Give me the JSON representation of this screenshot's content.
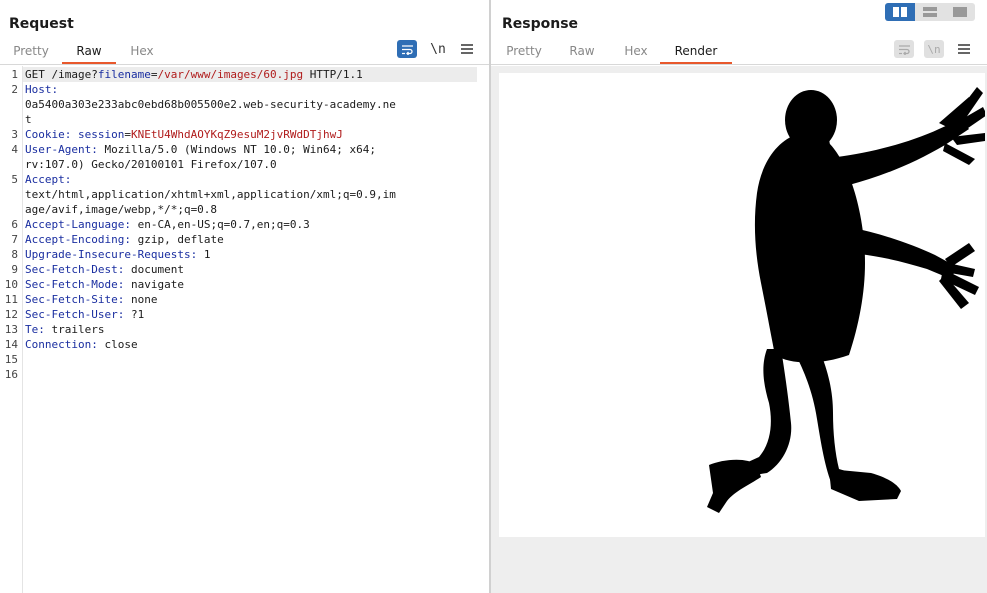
{
  "request": {
    "title": "Request",
    "tabs": [
      "Pretty",
      "Raw",
      "Hex"
    ],
    "active_tab": "Raw",
    "tools": {
      "wrap": "wrap-lines-icon",
      "newline": "\\n",
      "menu": "menu-icon"
    },
    "lines": [
      {
        "n": "1",
        "parts": [
          {
            "t": "GET /image?",
            "c": "plain"
          },
          {
            "t": "filename",
            "c": "pk"
          },
          {
            "t": "=",
            "c": "plain"
          },
          {
            "t": "/var/www/images/60.jpg",
            "c": "pv"
          },
          {
            "t": " HTTP/1.1",
            "c": "plain"
          }
        ]
      },
      {
        "n": "2",
        "parts": [
          {
            "t": "Host:",
            "c": "hk"
          }
        ]
      },
      {
        "n": "",
        "parts": [
          {
            "t": "0a5400a303e233abc0ebd68b005500e2.web-security-academy.ne",
            "c": "plain"
          }
        ]
      },
      {
        "n": "",
        "parts": [
          {
            "t": "t",
            "c": "plain"
          }
        ]
      },
      {
        "n": "3",
        "parts": [
          {
            "t": "Cookie: ",
            "c": "hk"
          },
          {
            "t": "session",
            "c": "pk"
          },
          {
            "t": "=",
            "c": "plain"
          },
          {
            "t": "KNEtU4WhdAOYKqZ9esuM2jvRWdDTjhwJ",
            "c": "pv"
          }
        ]
      },
      {
        "n": "4",
        "parts": [
          {
            "t": "User-Agent: ",
            "c": "hk"
          },
          {
            "t": "Mozilla/5.0 (Windows NT 10.0; Win64; x64;",
            "c": "plain"
          }
        ]
      },
      {
        "n": "",
        "parts": [
          {
            "t": "rv:107.0) Gecko/20100101 Firefox/107.0",
            "c": "plain"
          }
        ]
      },
      {
        "n": "5",
        "parts": [
          {
            "t": "Accept:",
            "c": "hk"
          }
        ]
      },
      {
        "n": "",
        "parts": [
          {
            "t": "text/html,application/xhtml+xml,application/xml;q=0.9,im",
            "c": "plain"
          }
        ]
      },
      {
        "n": "",
        "parts": [
          {
            "t": "age/avif,image/webp,*/*;q=0.8",
            "c": "plain"
          }
        ]
      },
      {
        "n": "6",
        "parts": [
          {
            "t": "Accept-Language: ",
            "c": "hk"
          },
          {
            "t": "en-CA,en-US;q=0.7,en;q=0.3",
            "c": "plain"
          }
        ]
      },
      {
        "n": "7",
        "parts": [
          {
            "t": "Accept-Encoding: ",
            "c": "hk"
          },
          {
            "t": "gzip, deflate",
            "c": "plain"
          }
        ]
      },
      {
        "n": "8",
        "parts": [
          {
            "t": "Upgrade-Insecure-Requests: ",
            "c": "hk"
          },
          {
            "t": "1",
            "c": "plain"
          }
        ]
      },
      {
        "n": "9",
        "parts": [
          {
            "t": "Sec-Fetch-Dest: ",
            "c": "hk"
          },
          {
            "t": "document",
            "c": "plain"
          }
        ]
      },
      {
        "n": "10",
        "parts": [
          {
            "t": "Sec-Fetch-Mode: ",
            "c": "hk"
          },
          {
            "t": "navigate",
            "c": "plain"
          }
        ]
      },
      {
        "n": "11",
        "parts": [
          {
            "t": "Sec-Fetch-Site: ",
            "c": "hk"
          },
          {
            "t": "none",
            "c": "plain"
          }
        ]
      },
      {
        "n": "12",
        "parts": [
          {
            "t": "Sec-Fetch-User: ",
            "c": "hk"
          },
          {
            "t": "?1",
            "c": "plain"
          }
        ]
      },
      {
        "n": "13",
        "parts": [
          {
            "t": "Te: ",
            "c": "hk"
          },
          {
            "t": "trailers",
            "c": "plain"
          }
        ]
      },
      {
        "n": "14",
        "parts": [
          {
            "t": "Connection: ",
            "c": "hk"
          },
          {
            "t": "close",
            "c": "plain"
          }
        ]
      },
      {
        "n": "15",
        "parts": []
      },
      {
        "n": "16",
        "parts": []
      }
    ]
  },
  "response": {
    "title": "Response",
    "tabs": [
      "Pretty",
      "Raw",
      "Hex",
      "Render"
    ],
    "active_tab": "Render",
    "tools": {
      "wrap": "wrap-lines-icon",
      "newline": "\\n",
      "menu": "menu-icon"
    },
    "render_image": "silhouette-figure-image"
  },
  "layout_toggle": [
    "split-horizontal-icon",
    "split-vertical-icon",
    "single-panel-icon"
  ],
  "colors": {
    "accent": "#e8582c",
    "toggle_on": "#2f6eb5",
    "header_key": "#1a2ea0",
    "param_value": "#b01c1c"
  }
}
